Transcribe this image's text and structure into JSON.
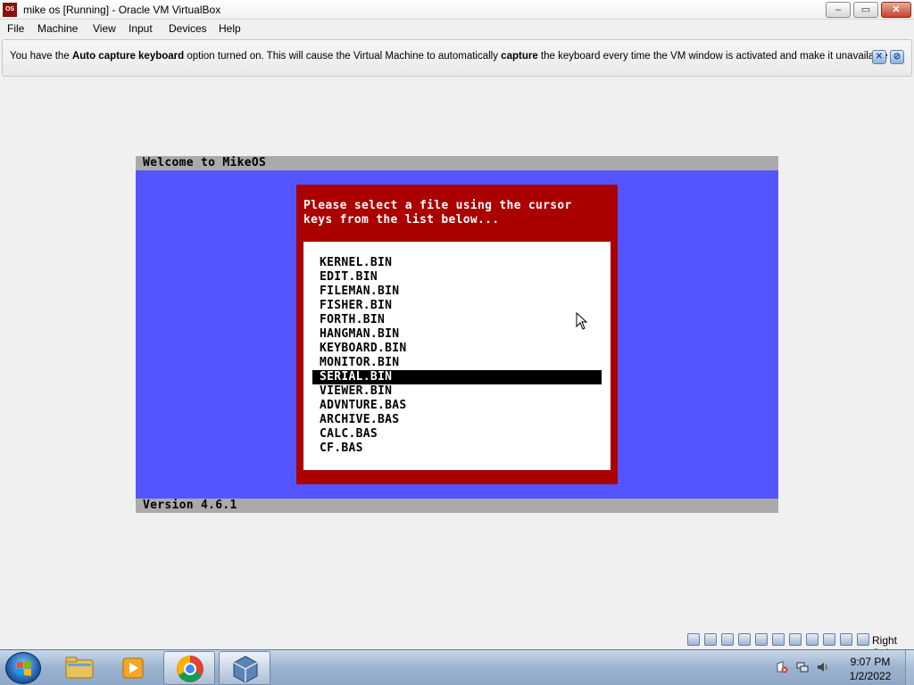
{
  "window": {
    "title": "mike os [Running] - Oracle VM VirtualBox",
    "icon_text": "OS",
    "controls": {
      "minimize": "–",
      "maximize": "▭",
      "close": "✕"
    }
  },
  "menu": [
    "File",
    "Machine",
    "View",
    "Input",
    "Devices",
    "Help"
  ],
  "infobar": {
    "part1": "You have the ",
    "bold1": "Auto capture keyboard",
    "part2": " option turned on. This will cause the Virtual Machine to automatically ",
    "bold2": "capture",
    "part3": " the keyboard every time the VM window is activated and make it unavailable to"
  },
  "vm": {
    "header": "Welcome to MikeOS",
    "footer": "Version 4.6.1",
    "prompt_line1": "Please select a file using the cursor",
    "prompt_line2": "keys from the list below...",
    "files": [
      "KERNEL.BIN",
      "EDIT.BIN",
      "FILEMAN.BIN",
      "FISHER.BIN",
      "FORTH.BIN",
      "HANGMAN.BIN",
      "KEYBOARD.BIN",
      "MONITOR.BIN",
      "SERIAL.BIN",
      "VIEWER.BIN",
      "ADVNTURE.BAS",
      "ARCHIVE.BAS",
      "CALC.BAS",
      "CF.BAS"
    ],
    "selected_index": 8,
    "colors": {
      "background": "#5555ff",
      "bars": "#aaaaaa",
      "dialog": "#aa0000",
      "list": "#ffffff"
    }
  },
  "statusbar": {
    "icons": [
      "hard-disk-icon",
      "optical-drive-icon",
      "floppy-icon",
      "usb-icon",
      "network-icon",
      "shared-folder-icon",
      "display-icon",
      "recording-icon",
      "cpu-icon",
      "mouse-integration-icon",
      "keyboard-capture-icon"
    ],
    "host_key": "Right Ctrl"
  },
  "taskbar": {
    "apps": [
      "file-explorer-icon",
      "media-player-icon",
      "chrome-icon",
      "virtualbox-icon"
    ],
    "tray_icons": [
      "action-center-icon",
      "network-tray-icon",
      "volume-icon"
    ],
    "time": "9:07 PM",
    "date": "1/2/2022"
  }
}
